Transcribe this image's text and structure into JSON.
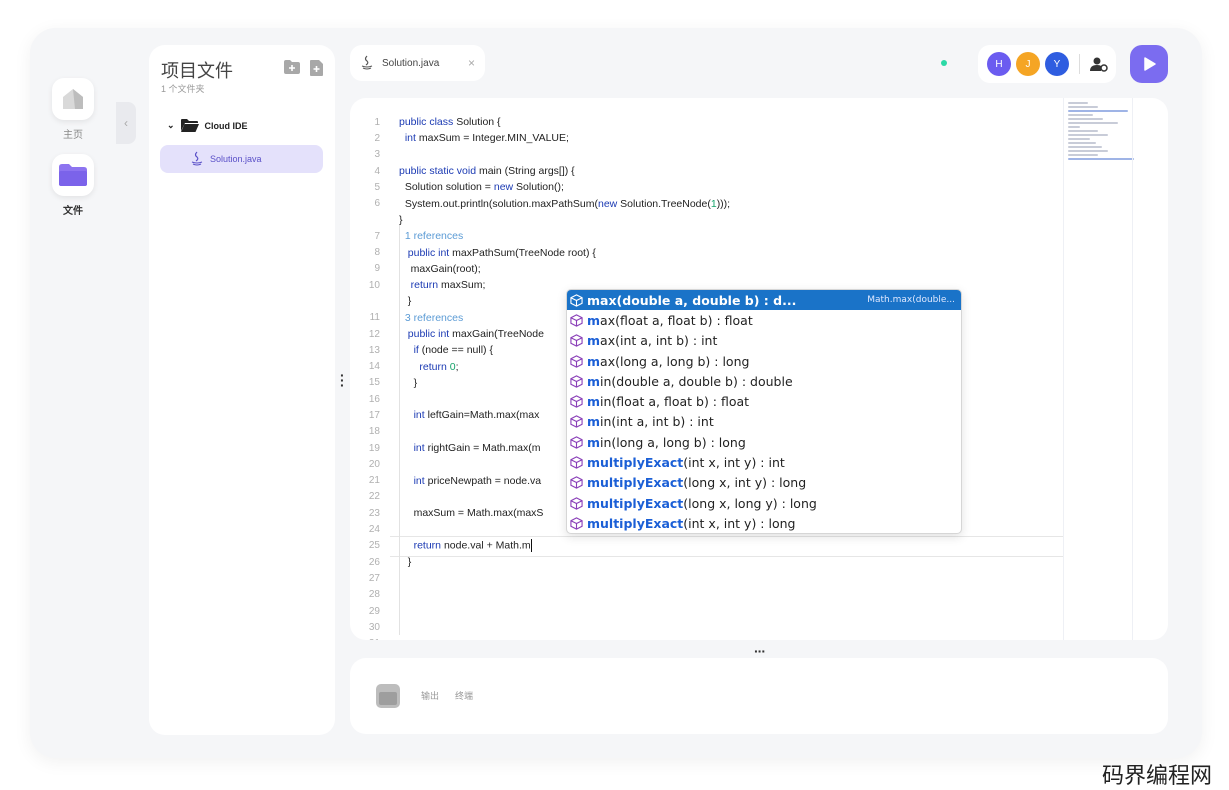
{
  "nav": {
    "home_label": "主页",
    "files_label": "文件"
  },
  "files_panel": {
    "title": "项目文件",
    "subtitle": "1 个文件夹",
    "folder_name": "Cloud IDE",
    "file_name": "Solution.java"
  },
  "tab": {
    "file_name": "Solution.java",
    "close": "×"
  },
  "users": [
    {
      "initial": "H",
      "color": "#6b5cf0"
    },
    {
      "initial": "J",
      "color": "#f5a524"
    },
    {
      "initial": "Y",
      "color": "#2f5de0"
    }
  ],
  "code_lines": [
    {
      "n": "1",
      "html": "<span class='kw'>public class</span> Solution {"
    },
    {
      "n": "2",
      "html": "  <span class='kw'>int</span> maxSum = Integer.MIN_VALUE;"
    },
    {
      "n": "3",
      "html": ""
    },
    {
      "n": "4",
      "html": "<span class='kw'>public static void</span> main (String args[]) {"
    },
    {
      "n": "5",
      "html": "  Solution solution = <span class='kw'>new</span> Solution();"
    },
    {
      "n": "6",
      "html": "  System.out.println(solution.maxPathSum(<span class='kw'>new</span> Solution.TreeNode(<span class='num'>1</span>)));"
    },
    {
      "n": "",
      "html": "}"
    },
    {
      "n": "7",
      "html": "  <span class='ref'>1 references</span>"
    },
    {
      "n": "8",
      "html": "   <span class='kw'>public int</span> maxPathSum(TreeNode root) {"
    },
    {
      "n": "9",
      "html": "    maxGain(root);"
    },
    {
      "n": "10",
      "html": "    <span class='kw'>return</span> maxSum;"
    },
    {
      "n": "",
      "html": "   }"
    },
    {
      "n": "11",
      "html": "  <span class='ref'>3 references</span>"
    },
    {
      "n": "12",
      "html": "   <span class='kw'>public int</span> maxGain(TreeNode"
    },
    {
      "n": "13",
      "html": "     <span class='kw'>if</span> (node == null) {"
    },
    {
      "n": "14",
      "html": "       <span class='kw'>return</span> <span class='num'>0</span>;"
    },
    {
      "n": "15",
      "html": "     }"
    },
    {
      "n": "16",
      "html": ""
    },
    {
      "n": "17",
      "html": "     <span class='kw'>int</span> leftGain=Math.max(max"
    },
    {
      "n": "18",
      "html": ""
    },
    {
      "n": "19",
      "html": "     <span class='kw'>int</span> rightGain = Math.max(m"
    },
    {
      "n": "20",
      "html": ""
    },
    {
      "n": "21",
      "html": "     <span class='kw'>int</span> priceNewpath = node.va"
    },
    {
      "n": "22",
      "html": ""
    },
    {
      "n": "23",
      "html": "     maxSum = Math.max(maxS"
    },
    {
      "n": "24",
      "html": ""
    },
    {
      "n": "25",
      "html": "     <span class='kw'>return</span> node.val + Math.m<span class='caret'></span>"
    },
    {
      "n": "26",
      "html": "   }"
    },
    {
      "n": "27",
      "html": ""
    },
    {
      "n": "28",
      "html": ""
    },
    {
      "n": "29",
      "html": ""
    },
    {
      "n": "30",
      "html": ""
    },
    {
      "n": "31",
      "html": ""
    }
  ],
  "suggestions": [
    {
      "m": "m",
      "rest": "ax(double a, double b) : d...",
      "detail": "Math.max(double...",
      "selected": true
    },
    {
      "m": "m",
      "rest": "ax(float a, float b) : float"
    },
    {
      "m": "m",
      "rest": "ax(int a, int b) : int"
    },
    {
      "m": "m",
      "rest": "ax(long a, long b) : long"
    },
    {
      "m": "m",
      "rest": "in(double a, double b) : double"
    },
    {
      "m": "m",
      "rest": "in(float a, float b) : float"
    },
    {
      "m": "m",
      "rest": "in(int a, int b) : int"
    },
    {
      "m": "m",
      "rest": "in(long a, long b) : long"
    },
    {
      "m": "multiplyExact",
      "rest": "(int x, int y) : int"
    },
    {
      "m": "multiplyExact",
      "rest": "(long x, int y) : long"
    },
    {
      "m": "multiplyExact",
      "rest": "(long x, long y) : long"
    },
    {
      "m": "multiplyExact",
      "rest": "(int x, int y) : long"
    }
  ],
  "bottom_panel": {
    "tab_output": "输出",
    "tab_terminal": "终端"
  },
  "watermark": "码界编程网",
  "colors": {
    "accent": "#7b6cf0",
    "selection": "#1a73c8",
    "online": "#2bd9a6"
  }
}
